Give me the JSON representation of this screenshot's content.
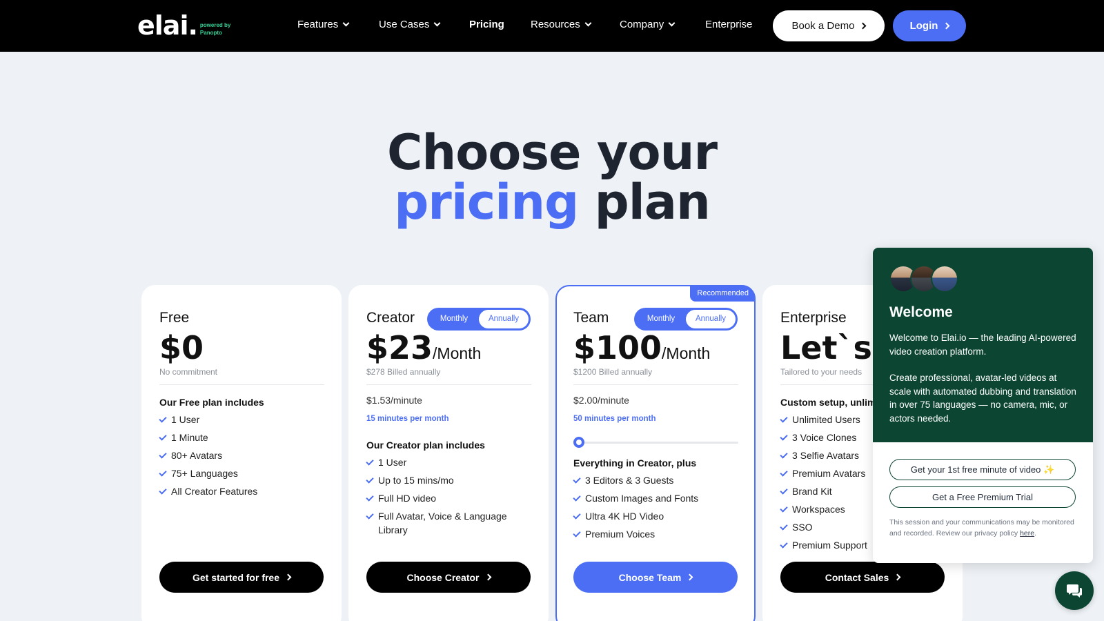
{
  "nav": {
    "logo_word": "elai.",
    "logo_sub_line1": "powered by",
    "logo_sub_line2": "Panopto",
    "items": [
      {
        "label": "Features"
      },
      {
        "label": "Use Cases"
      },
      {
        "label": "Pricing"
      },
      {
        "label": "Resources"
      },
      {
        "label": "Company"
      },
      {
        "label": "Enterprise"
      }
    ],
    "demo_label": "Book a Demo",
    "login_label": "Login"
  },
  "hero": {
    "line1": "Choose your",
    "accent": "pricing",
    "rest": "plan"
  },
  "plans": [
    {
      "name": "Free",
      "price": "$0",
      "per": "",
      "billed": "No commitment",
      "features_title": "Our Free plan includes",
      "features": [
        "1 User",
        "1 Minute",
        "80+ Avatars",
        "75+ Languages",
        "All Creator Features"
      ],
      "cta": "Get started for free"
    },
    {
      "name": "Creator",
      "price": "$23",
      "per": "/Month",
      "billed": "$278 Billed annually",
      "rate": "$1.53/minute",
      "minutes": "15 minutes per month",
      "toggle": [
        "Monthly",
        "Annually"
      ],
      "features_title": "Our Creator plan includes",
      "features": [
        "1 User",
        "Up to 15 mins/mo",
        "Full HD video",
        "Full Avatar, Voice & Language Library"
      ],
      "cta": "Choose Creator"
    },
    {
      "name": "Team",
      "badge": "Recommended",
      "price": "$100",
      "per": "/Month",
      "billed": "$1200 Billed annually",
      "rate": "$2.00/minute",
      "minutes": "50 minutes per month",
      "toggle": [
        "Monthly",
        "Annually"
      ],
      "slider_fraction": 0,
      "features_title": "Everything in Creator, plus",
      "features": [
        "3 Editors & 3 Guests",
        "Custom Images and Fonts",
        "Ultra 4K HD Video",
        "Premium Voices"
      ],
      "cta": "Choose Team"
    },
    {
      "name": "Enterprise",
      "price": "Let`s T",
      "per": "",
      "billed": "Tailored to your needs",
      "features_title": "Custom setup, unlim",
      "features": [
        "Unlimited Users",
        "3 Voice Clones",
        "3 Selfie Avatars",
        "Premium Avatars",
        "Brand Kit",
        "Workspaces",
        "SSO",
        "Premium Support"
      ],
      "cta": "Contact Sales"
    }
  ],
  "chat": {
    "title": "Welcome",
    "para1": "Welcome to Elai.io — the leading AI-powered video creation platform.",
    "para2": "Create professional, avatar-led videos at scale with automated dubbing and translation in over 75 languages — no camera, mic, or actors needed.",
    "btn1": "Get your 1st free minute of video ✨",
    "btn2": "Get a Free Premium Trial",
    "note": "This session and your communications may be monitored and recorded. Review our privacy policy",
    "note_link": "here",
    "note_end": "."
  },
  "colors": {
    "accent": "#4c6ef5",
    "chat_green": "#0c4633",
    "logo_green": "#34d399"
  }
}
